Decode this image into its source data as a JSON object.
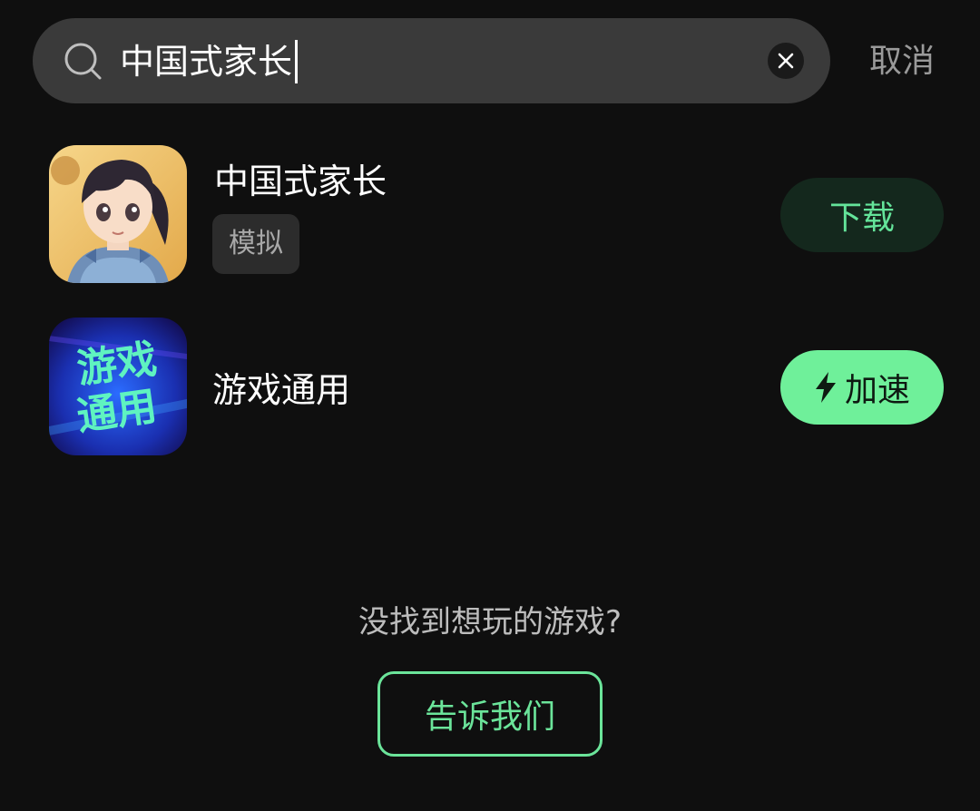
{
  "search": {
    "query": "中国式家长",
    "cancel_label": "取消"
  },
  "results": [
    {
      "title": "中国式家长",
      "tag": "模拟",
      "action_label": "下载",
      "icon": "girl-character-avatar"
    },
    {
      "title": "游戏通用",
      "icon_text_line1": "游戏",
      "icon_text_line2": "通用",
      "action_label": "加速",
      "action_icon": "lightning-icon"
    }
  ],
  "footer": {
    "prompt": "没找到想玩的游戏?",
    "button_label": "告诉我们"
  },
  "colors": {
    "accent": "#6ff09a",
    "background": "#0f0f0f",
    "search_bg": "#3a3a3a"
  }
}
